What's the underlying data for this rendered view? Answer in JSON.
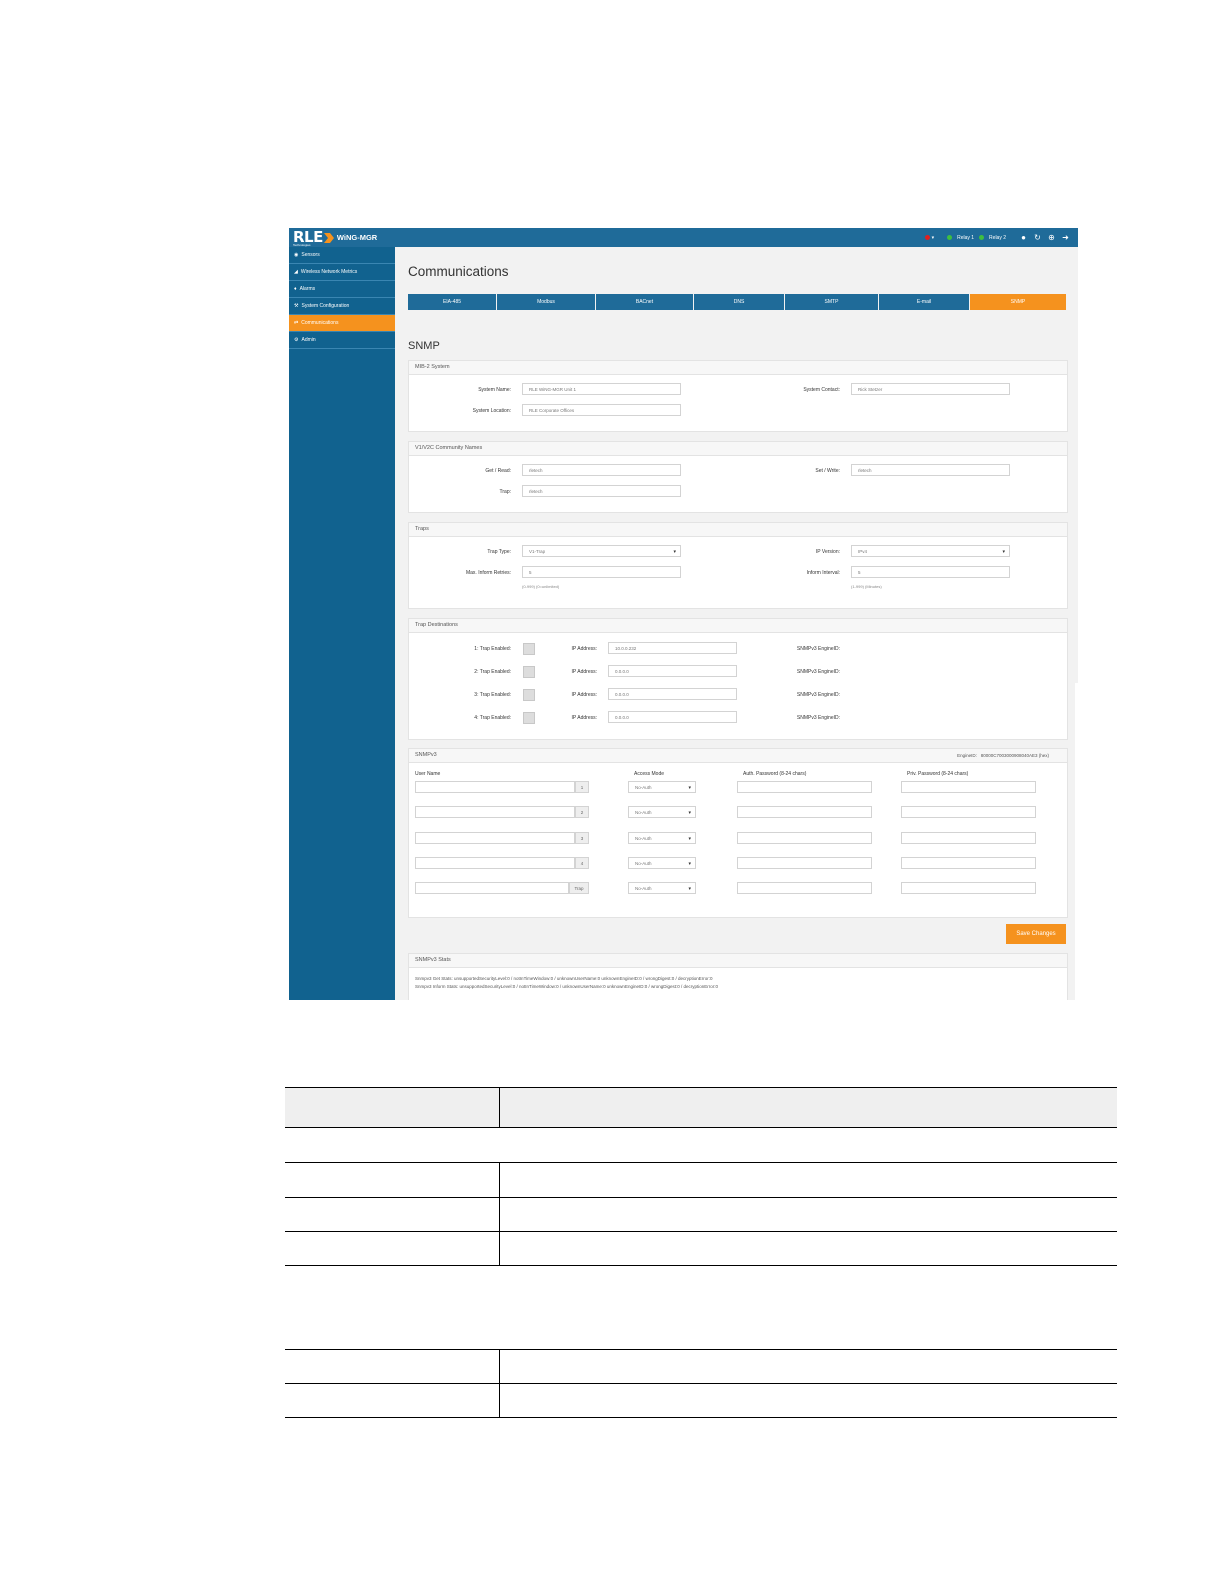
{
  "app": {
    "logo_text": "RLE",
    "logo_sub": "Technologies",
    "product": "WiNG-MGR"
  },
  "topbar": {
    "relay1": "Relay 1",
    "relay2": "Relay 2",
    "status_colors": {
      "alarm": "#e02020",
      "relay_ok": "#3fbf3f"
    }
  },
  "sidebar": {
    "items": [
      {
        "label": "Sensors",
        "icon": "sensors-icon"
      },
      {
        "label": "Wireless Network Metrics",
        "icon": "signal-icon"
      },
      {
        "label": "Alarms",
        "icon": "bell-icon"
      },
      {
        "label": "System Configuration",
        "icon": "wrench-icon"
      },
      {
        "label": "Communications",
        "icon": "exchange-icon",
        "active": true
      },
      {
        "label": "Admin",
        "icon": "gears-icon"
      }
    ]
  },
  "page": {
    "title": "Communications",
    "section_title": "SNMP"
  },
  "tabs": [
    "EIA-485",
    "Modbus",
    "BACnet",
    "DNS",
    "SMTP",
    "E-mail",
    "SNMP"
  ],
  "active_tab": "SNMP",
  "mib2": {
    "title": "MIB-2 System",
    "system_name_label": "System Name:",
    "system_name": "RLE WiNG-MGR Unit 1",
    "system_location_label": "System Location:",
    "system_location": "RLE Corporate Offices",
    "system_contact_label": "System Contact:",
    "system_contact": "Rick Stetzer"
  },
  "community": {
    "title": "V1/V2C Community Names",
    "get_label": "Get / Read:",
    "get": "rletech",
    "set_label": "Set / Write:",
    "set": "rletech",
    "trap_label": "Trap:",
    "trap": "rletech"
  },
  "traps": {
    "title": "Traps",
    "trap_type_label": "Trap Type:",
    "trap_type": "V1-Trap",
    "ip_version_label": "IP Version:",
    "ip_version": "IPv4",
    "max_retries_label": "Max. Inform Retries:",
    "max_retries": "5",
    "max_retries_hint": "(0-999) (0=unlimited)",
    "inform_interval_label": "Inform Interval:",
    "inform_interval": "5",
    "inform_interval_hint": "(1-999) (Minutes)"
  },
  "trap_destinations": {
    "title": "Trap Destinations",
    "ip_label": "IP Address:",
    "engine_label": "SNMPv3 EngineID:",
    "rows": [
      {
        "label": "1: Trap Enabled:",
        "ip": "10.0.0.232"
      },
      {
        "label": "2: Trap Enabled:",
        "ip": "0.0.0.0"
      },
      {
        "label": "3: Trap Enabled:",
        "ip": "0.0.0.0"
      },
      {
        "label": "4: Trap Enabled:",
        "ip": "0.0.0.0"
      }
    ]
  },
  "snmpv3": {
    "title": "SNMPv3",
    "engine_label": "EngineID:",
    "engine_value": "80000C7003000908040AE3 (hex)",
    "col_user": "User Name",
    "col_access": "Access Mode",
    "col_auth": "Auth. Password (8-24 chars)",
    "col_priv": "Priv. Password (8-24 chars)",
    "rows": [
      {
        "addon": "1",
        "access": "No-Auth"
      },
      {
        "addon": "2",
        "access": "No-Auth"
      },
      {
        "addon": "3",
        "access": "No-Auth"
      },
      {
        "addon": "4",
        "access": "No-Auth"
      },
      {
        "addon": "Trap",
        "access": "No-Auth"
      }
    ]
  },
  "save_button": "Save Changes",
  "stats": {
    "title": "SNMPv3 Stats",
    "get_line": "Snmpv3 Get Stats: unsupportedSecurityLevel:0 / notInTimeWindow:0 / unknownUserName:0 unknownEngineID:0 / wrongDigest:0 / decryptionError:0",
    "inform_line": "Snmpv3 Inform Stats: unsupportedSecurityLevel:0 / notInTimeWindow:0 / unknownUserName:0 unknownEngineID:0 / wrongDigest:0 / decryptionError:0"
  }
}
